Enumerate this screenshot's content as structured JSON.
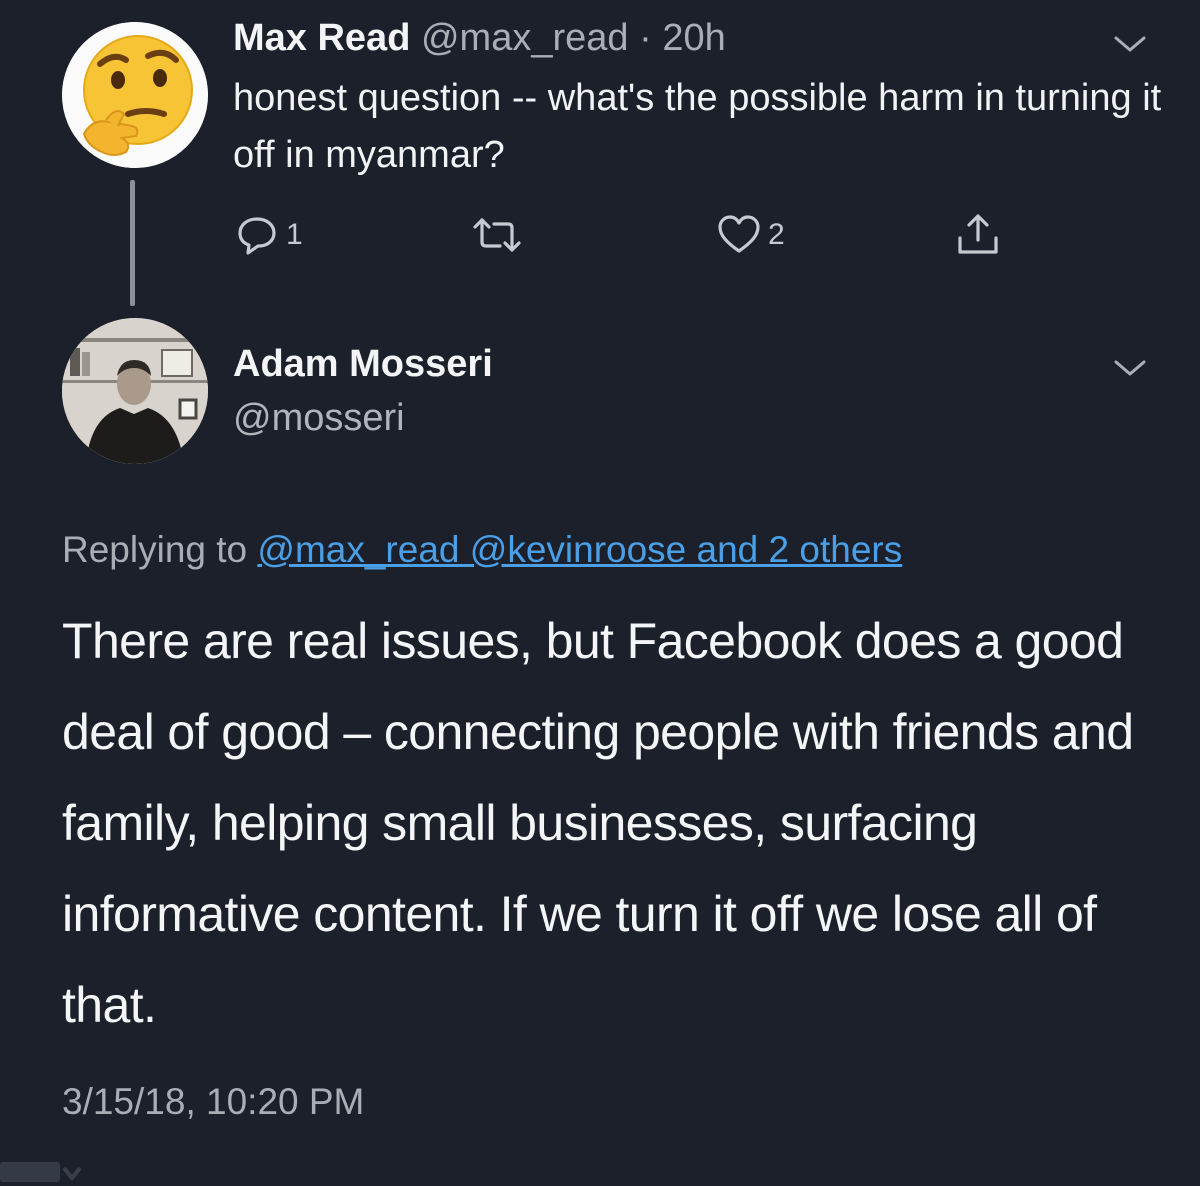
{
  "tweet1": {
    "author_name": "Max Read",
    "author_handle": "@max_read",
    "separator": " · ",
    "time_ago": "20h",
    "text": "honest question -- what's the possible harm in turning it off in myanmar?",
    "reply_count": "1",
    "like_count": "2",
    "avatar_icon": "thinking-face-emoji"
  },
  "tweet2": {
    "author_name": "Adam Mosseri",
    "author_handle": "@mosseri",
    "replying_prefix": "Replying to ",
    "replying_mentions": "@max_read @kevinroose and 2 others",
    "text": "There are real issues, but Facebook does a good deal of good – connecting people with friends and family, helping small businesses, surfacing informative content. If we turn it off we lose all of that.",
    "timestamp": "3/15/18, 10:20 PM"
  },
  "colors": {
    "background": "#1b202a",
    "link": "#4a9fe6",
    "secondary_text": "#a9aeb5",
    "thread_line": "#8b9097"
  }
}
